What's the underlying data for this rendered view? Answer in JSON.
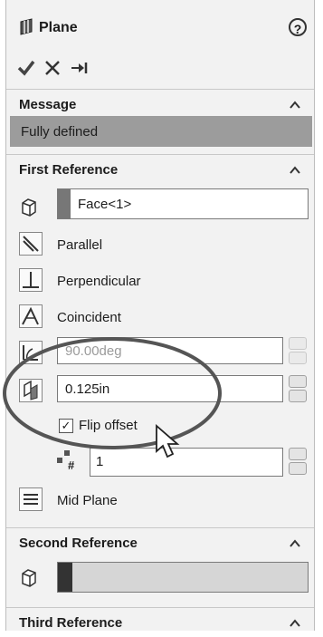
{
  "header": {
    "title": "Plane",
    "help_icon_text": "?"
  },
  "message_section": {
    "label": "Message",
    "text": "Fully defined"
  },
  "first_reference": {
    "label": "First Reference",
    "selection": "Face<1>",
    "options": {
      "parallel": "Parallel",
      "perpendicular": "Perpendicular",
      "coincident": "Coincident"
    },
    "angle_value": "90.00deg",
    "offset_value": "0.125in",
    "flip_offset_label": "Flip offset",
    "flip_offset_checked": true,
    "count_value": "1",
    "mid_plane_label": "Mid Plane"
  },
  "second_reference": {
    "label": "Second Reference"
  },
  "third_reference": {
    "label": "Third Reference"
  }
}
